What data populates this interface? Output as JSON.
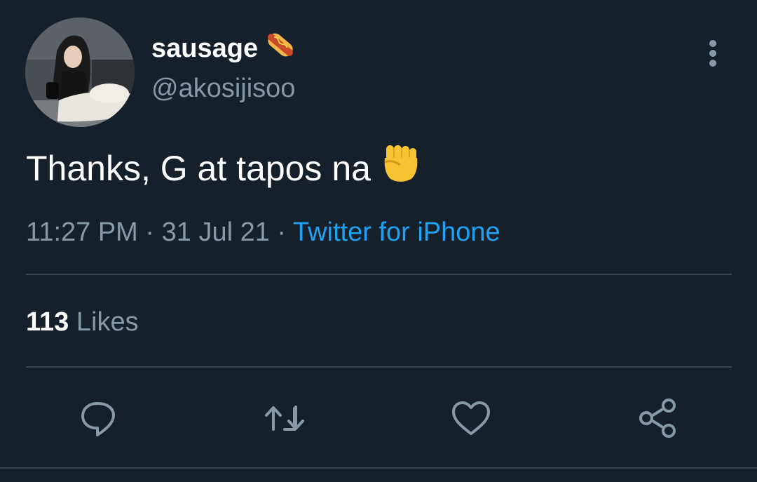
{
  "author": {
    "display_name": "sausage",
    "name_emoji": "hotdog-icon",
    "handle": "@akosijisoo"
  },
  "tweet": {
    "text": "Thanks, G at tapos na",
    "text_emoji": "raised-fist-icon"
  },
  "meta": {
    "time": "11:27 PM",
    "sep1": " · ",
    "date": "31 Jul 21",
    "sep2": " · ",
    "source": "Twitter for iPhone"
  },
  "stats": {
    "likes_count": "113",
    "likes_label": "Likes"
  },
  "actions": [
    "reply-icon",
    "retweet-icon",
    "like-icon",
    "share-icon"
  ],
  "colors": {
    "background": "#15202b",
    "secondary_text": "#8899a6",
    "link": "#1da1f2",
    "divider": "#38444d"
  }
}
